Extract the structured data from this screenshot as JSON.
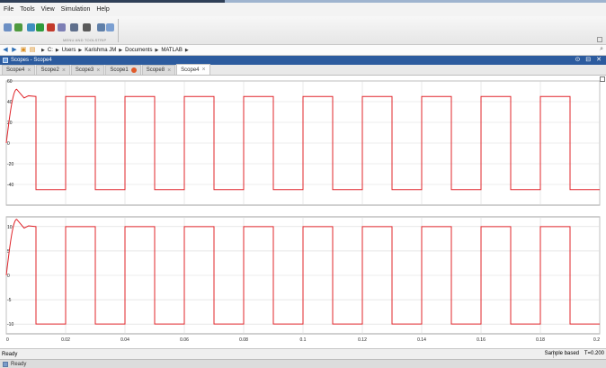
{
  "menu": [
    "File",
    "Tools",
    "View",
    "Simulation",
    "Help"
  ],
  "toolbar": {
    "caption": "MENU AND TOOLSTRIP",
    "icons": [
      {
        "name": "open-icon",
        "color": "#6c8fc4"
      },
      {
        "name": "back-icon",
        "color": "#4f9a3f"
      },
      {
        "name": "step-back-icon",
        "color": "#3f8fbf"
      },
      {
        "name": "run-icon",
        "color": "#2e9b3c"
      },
      {
        "name": "stop-icon",
        "color": "#c33a2b"
      },
      {
        "name": "config-icon",
        "color": "#7d7fb5"
      },
      {
        "name": "zoom-icon",
        "color": "#5f6f8c"
      },
      {
        "name": "autoscale-icon",
        "color": "#5a5a5a"
      },
      {
        "name": "cursor-icon",
        "color": "#5f7fa8"
      },
      {
        "name": "measure-icon",
        "color": "#7b9fd1"
      }
    ]
  },
  "address": {
    "crumbs": [
      "C:",
      "Users",
      "Karishma JM",
      "Documents",
      "MATLAB"
    ]
  },
  "window": {
    "title": "Scopes - Scope4"
  },
  "tabs": [
    {
      "label": "Scope4",
      "closable": true,
      "active": false,
      "warn": false
    },
    {
      "label": "Scope2",
      "closable": true,
      "active": false,
      "warn": false
    },
    {
      "label": "Scope3",
      "closable": true,
      "active": false,
      "warn": false
    },
    {
      "label": "Scope1",
      "closable": false,
      "active": false,
      "warn": true
    },
    {
      "label": "Scope8",
      "closable": true,
      "active": false,
      "warn": false
    },
    {
      "label": "Scope4",
      "closable": true,
      "active": true,
      "warn": false
    }
  ],
  "status": {
    "ready": "Ready",
    "mode": "Sample based",
    "time": "T=0.200"
  },
  "bottom": {
    "ready": "Ready"
  },
  "chart_data": [
    {
      "type": "line",
      "title": "",
      "xlabel": "",
      "ylabel": "",
      "xlim": [
        0,
        0.2
      ],
      "ylim": [
        -60,
        60
      ],
      "yticks": [
        60,
        40,
        20,
        0,
        -20,
        -40
      ],
      "xticks": [],
      "grid": true,
      "series_color": "#e0242a",
      "wave": {
        "start": 0.0,
        "overshoot_peak": 52,
        "settle": 45,
        "high": 45,
        "low": -45,
        "first_fall": 0.01,
        "period": 0.02,
        "duty_high_start": 0.01
      }
    },
    {
      "type": "line",
      "title": "",
      "xlabel": "",
      "ylabel": "",
      "xlim": [
        0,
        0.2
      ],
      "ylim": [
        -12,
        12
      ],
      "yticks": [
        10,
        5,
        0,
        -5,
        -10
      ],
      "xticks": [
        0,
        0.02,
        0.04,
        0.06,
        0.08,
        0.1,
        0.12,
        0.14,
        0.16,
        0.18,
        0.2
      ],
      "xticklabels": [
        "0",
        "0.02",
        "0.04",
        "0.06",
        "0.08",
        "0.1",
        "0.12",
        "0.14",
        "0.16",
        "0.18",
        "0.2"
      ],
      "grid": true,
      "series_color": "#e0242a",
      "wave": {
        "start": 0.0,
        "overshoot_peak": 11.5,
        "settle": 10,
        "high": 10,
        "low": -10,
        "first_fall": 0.01,
        "period": 0.02,
        "duty_high_start": 0.01
      }
    }
  ]
}
